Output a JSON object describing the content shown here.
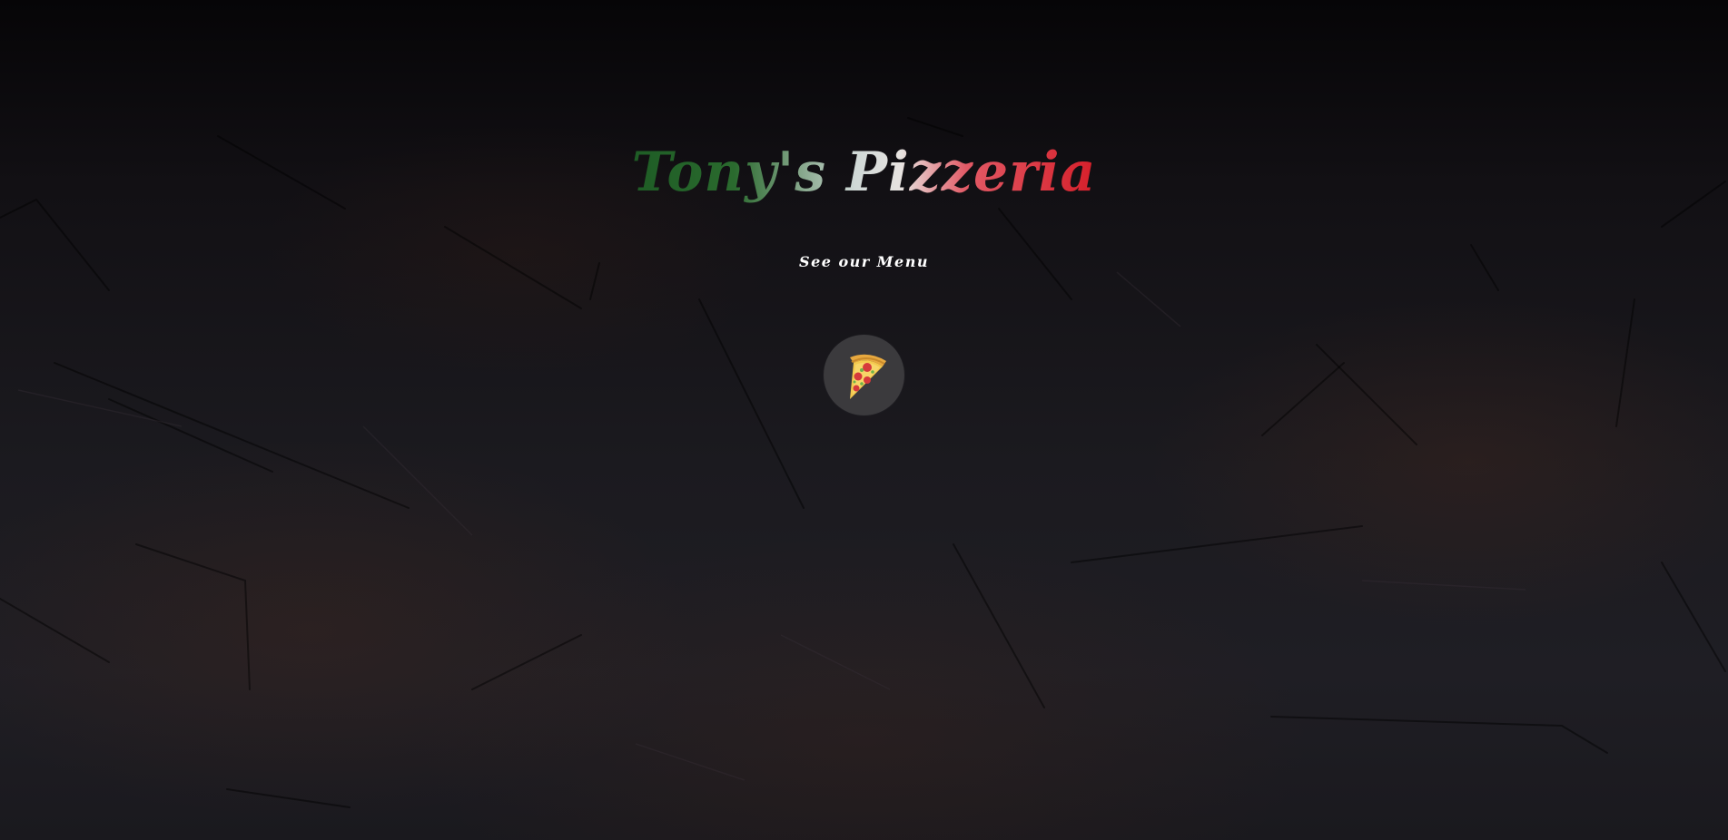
{
  "brand": {
    "title": "Tony's Pizzeria"
  },
  "nav": {
    "menu_label": "See our Menu"
  },
  "pizza_button": {
    "icon": "pizza-slice-icon"
  },
  "colors": {
    "background": "#16151a",
    "title_gradient": [
      "#1e5c25",
      "#e7e3e0",
      "#d61f2a"
    ],
    "menu_text": "#ffffff",
    "button_bg": "#3b3a3d"
  }
}
